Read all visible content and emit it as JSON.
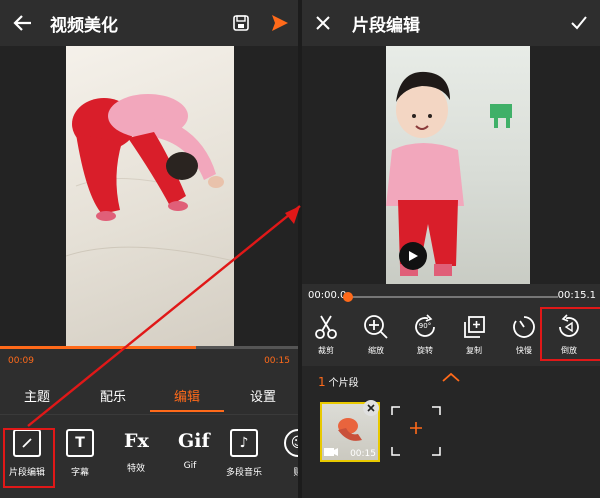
{
  "left": {
    "title": "视频美化",
    "times": {
      "current": "00:09",
      "total": "00:15"
    },
    "progress": 0.66,
    "tabs": [
      {
        "label": "主题",
        "active": false
      },
      {
        "label": "配乐",
        "active": false
      },
      {
        "label": "编辑",
        "active": true
      },
      {
        "label": "设置",
        "active": false
      }
    ],
    "tools": [
      {
        "label": "片段编辑",
        "icon": "edit-square-icon"
      },
      {
        "label": "字幕",
        "icon": "text-icon"
      },
      {
        "label": "特效",
        "icon": "fx-icon"
      },
      {
        "label": "Gif",
        "icon": "gif-icon"
      },
      {
        "label": "多段音乐",
        "icon": "music-note-icon"
      },
      {
        "label": "贴",
        "icon": "sticker-icon"
      }
    ],
    "icon_glyphs": {
      "text": "T",
      "fx": "Fx",
      "gif": "Gif",
      "music": "♪",
      "sticker": "☺"
    }
  },
  "right": {
    "title": "片段编辑",
    "times": {
      "current": "00:00.0",
      "total": "00:15.1"
    },
    "tools": [
      {
        "label": "裁剪",
        "icon": "scissors-icon"
      },
      {
        "label": "缩放",
        "icon": "zoom-in-icon"
      },
      {
        "label": "旋转",
        "icon": "rotate-90-icon"
      },
      {
        "label": "复制",
        "icon": "copy-icon"
      },
      {
        "label": "快慢",
        "icon": "speed-icon"
      },
      {
        "label": "倒放",
        "icon": "reverse-icon"
      }
    ],
    "rotate_badge": "90°",
    "clips": {
      "count": "1",
      "label": "个片段",
      "duration": "00:15"
    }
  },
  "colors": {
    "accent": "#ff6a1a",
    "highlight": "#e01818",
    "background": "#2e2e2e"
  }
}
